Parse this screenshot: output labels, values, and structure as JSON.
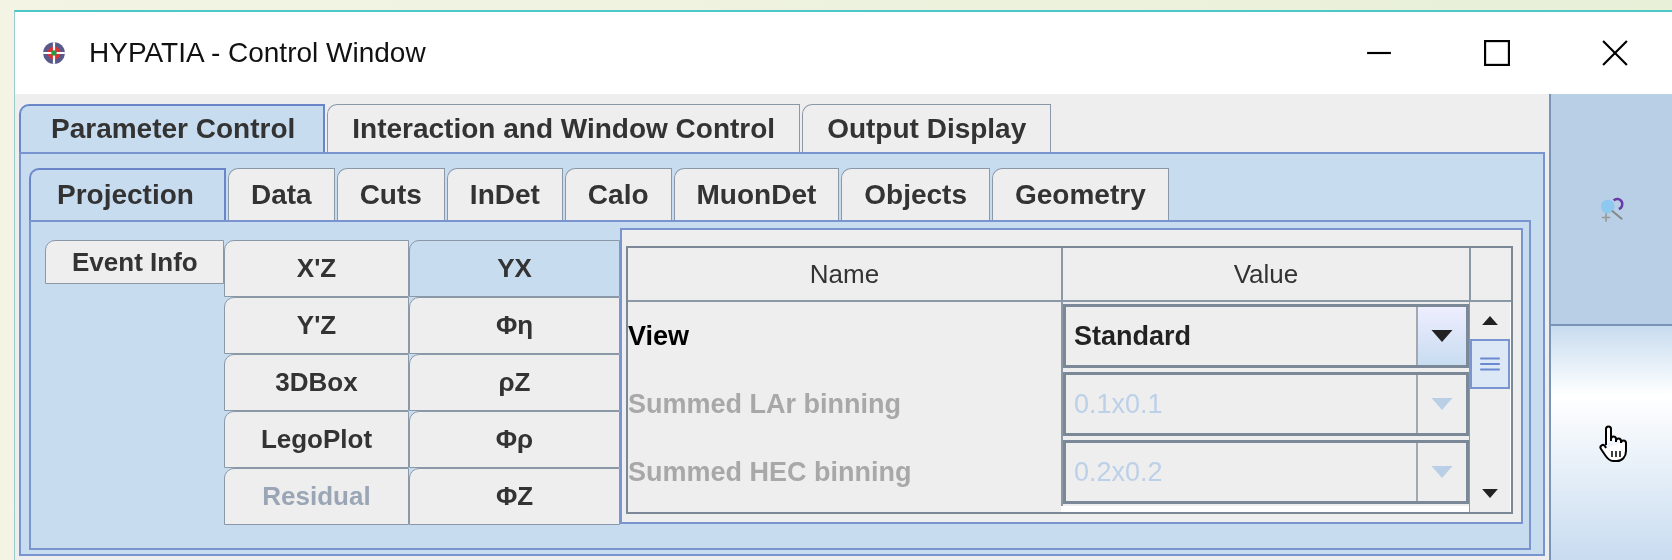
{
  "window": {
    "title": "HYPATIA - Control Window"
  },
  "outer_tabs": [
    {
      "label": "Parameter Control",
      "selected": true
    },
    {
      "label": "Interaction and Window Control",
      "selected": false
    },
    {
      "label": "Output Display",
      "selected": false
    }
  ],
  "inner_tabs": [
    {
      "label": "Projection",
      "selected": true
    },
    {
      "label": "Data",
      "selected": false
    },
    {
      "label": "Cuts",
      "selected": false
    },
    {
      "label": "InDet",
      "selected": false
    },
    {
      "label": "Calo",
      "selected": false
    },
    {
      "label": "MuonDet",
      "selected": false
    },
    {
      "label": "Objects",
      "selected": false
    },
    {
      "label": "Geometry",
      "selected": false
    }
  ],
  "event_info_tab": {
    "label": "Event Info",
    "selected": false
  },
  "projection_columns": [
    [
      {
        "label": "X'Z",
        "selected": false,
        "disabled": false
      },
      {
        "label": "Y'Z",
        "selected": false,
        "disabled": false
      },
      {
        "label": "3DBox",
        "selected": false,
        "disabled": false
      },
      {
        "label": "LegoPlot",
        "selected": false,
        "disabled": false
      },
      {
        "label": "Residual",
        "selected": false,
        "disabled": true
      }
    ],
    [
      {
        "label": "YX",
        "selected": true,
        "disabled": false
      },
      {
        "label": "Φη",
        "selected": false,
        "disabled": false
      },
      {
        "label": "ρZ",
        "selected": false,
        "disabled": false
      },
      {
        "label": "Φρ",
        "selected": false,
        "disabled": false
      },
      {
        "label": "ΦZ",
        "selected": false,
        "disabled": false
      }
    ]
  ],
  "table": {
    "columns": [
      "Name",
      "Value"
    ],
    "rows": [
      {
        "name": "View",
        "value": "Standard",
        "disabled": false
      },
      {
        "name": "Summed LAr binning",
        "value": "0.1x0.1",
        "disabled": true
      },
      {
        "name": "Summed HEC binning",
        "value": "0.2x0.2",
        "disabled": true
      }
    ]
  }
}
